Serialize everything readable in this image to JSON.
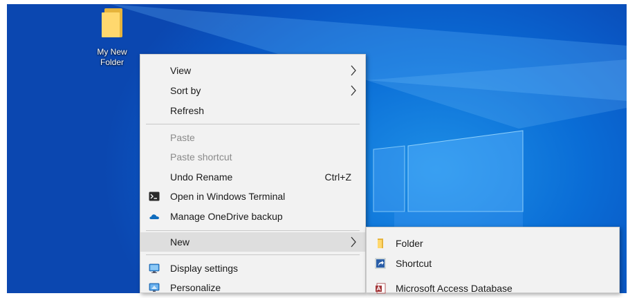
{
  "colors": {
    "desktop_bg": "#0a6dd6",
    "menu_bg": "#f2f2f2",
    "menu_hover": "#dedede",
    "disabled_text": "#8a8a8a"
  },
  "desktop": {
    "icons": [
      {
        "label_line1": "My New",
        "label_line2": "Folder",
        "icon": "folder-icon"
      }
    ]
  },
  "context_menu": {
    "items": {
      "view": {
        "label": "View",
        "has_submenu": true
      },
      "sort_by": {
        "label": "Sort by",
        "has_submenu": true
      },
      "refresh": {
        "label": "Refresh"
      },
      "paste": {
        "label": "Paste",
        "disabled": true
      },
      "paste_shortcut": {
        "label": "Paste shortcut",
        "disabled": true
      },
      "undo_rename": {
        "label": "Undo Rename",
        "shortcut": "Ctrl+Z"
      },
      "open_terminal": {
        "label": "Open in Windows Terminal",
        "icon": "terminal-icon"
      },
      "manage_onedrive": {
        "label": "Manage OneDrive backup",
        "icon": "onedrive-cloud-icon"
      },
      "new": {
        "label": "New",
        "has_submenu": true,
        "highlighted": true
      },
      "display_settings": {
        "label": "Display settings",
        "icon": "display-settings-icon"
      },
      "personalize": {
        "label": "Personalize",
        "icon": "personalize-icon"
      }
    }
  },
  "new_submenu": {
    "items": {
      "folder": {
        "label": "Folder",
        "icon": "folder-icon"
      },
      "shortcut": {
        "label": "Shortcut",
        "icon": "shortcut-icon"
      },
      "access_db": {
        "label": "Microsoft Access Database",
        "icon": "access-database-icon"
      }
    }
  }
}
